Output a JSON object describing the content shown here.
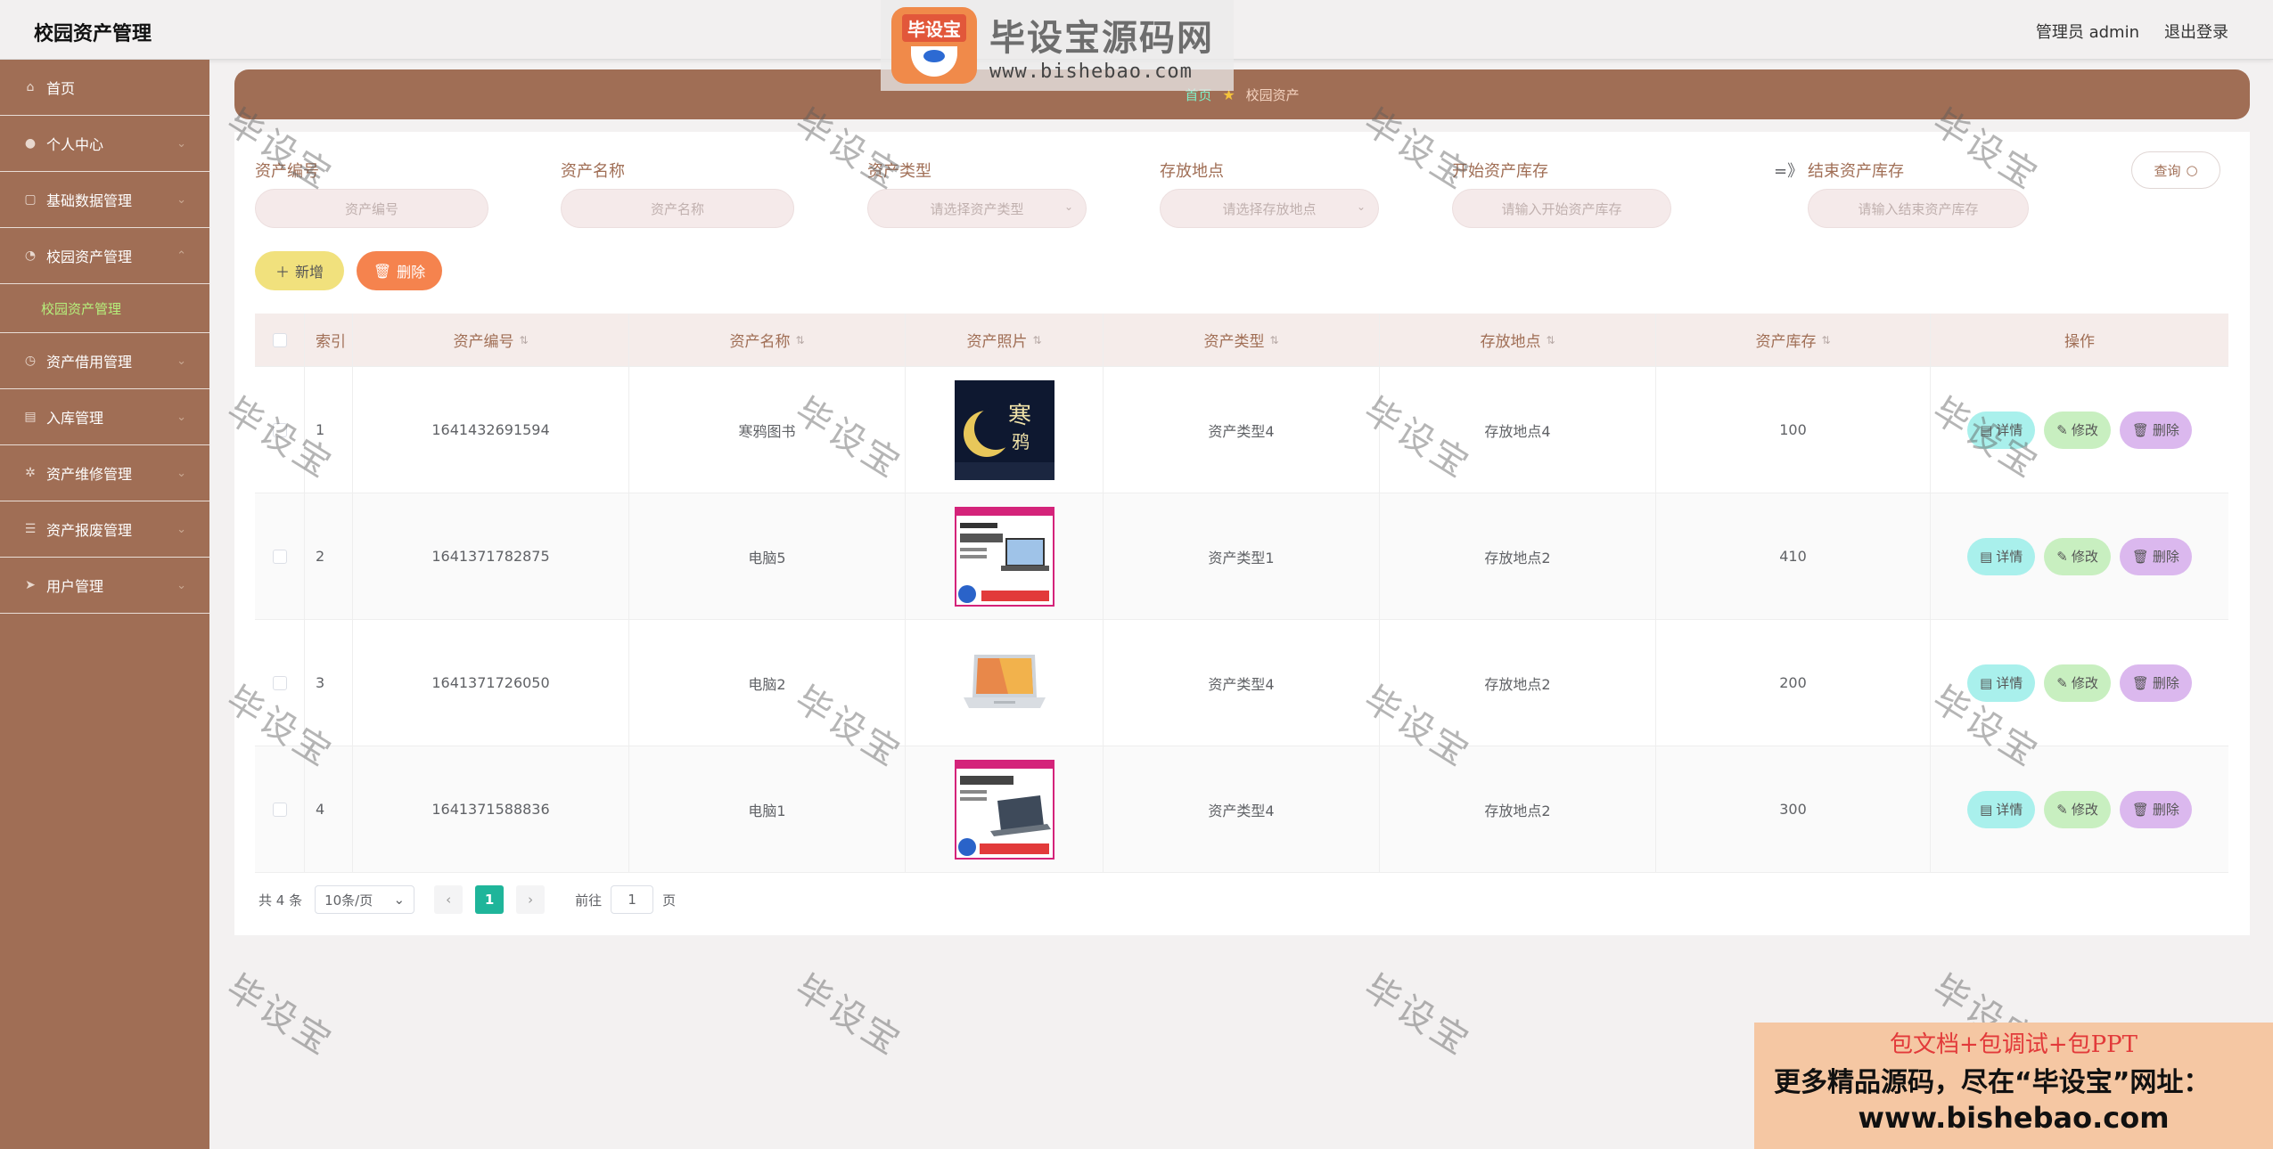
{
  "app": {
    "title": "校园资产管理"
  },
  "header": {
    "user_label": "管理员 admin",
    "logout_label": "退出登录"
  },
  "sidebar": {
    "items": [
      {
        "label": "首页",
        "icon": "home-icon",
        "glyph": "⌂",
        "has_children": false
      },
      {
        "label": "个人中心",
        "icon": "user-icon",
        "glyph": "●",
        "has_children": true
      },
      {
        "label": "基础数据管理",
        "icon": "document-icon",
        "glyph": "▢",
        "has_children": true
      },
      {
        "label": "校园资产管理",
        "icon": "chart-icon",
        "glyph": "◔",
        "has_children": true,
        "expanded": true,
        "children": [
          {
            "label": "校园资产管理"
          }
        ]
      },
      {
        "label": "资产借用管理",
        "icon": "clock-icon",
        "glyph": "◷",
        "has_children": true
      },
      {
        "label": "入库管理",
        "icon": "clipboard-icon",
        "glyph": "▤",
        "has_children": true
      },
      {
        "label": "资产维修管理",
        "icon": "gear-icon",
        "glyph": "✲",
        "has_children": true
      },
      {
        "label": "资产报废管理",
        "icon": "list-icon",
        "glyph": "☰",
        "has_children": true
      },
      {
        "label": "用户管理",
        "icon": "send-icon",
        "glyph": "➤",
        "has_children": true
      }
    ]
  },
  "breadcrumb": {
    "home": "首页",
    "current": "校园资产"
  },
  "search": {
    "fields": [
      {
        "label": "资产编号",
        "placeholder": "资产编号"
      },
      {
        "label": "资产名称",
        "placeholder": "资产名称"
      },
      {
        "label": "资产类型",
        "placeholder": "请选择资产类型"
      },
      {
        "label": "存放地点",
        "placeholder": "请选择存放地点"
      },
      {
        "label": "开始资产库存",
        "placeholder": "请输入开始资产库存"
      },
      {
        "label": "结束资产库存",
        "placeholder": "请输入结束资产库存"
      }
    ],
    "range_separator": "=》",
    "query_label": "查询"
  },
  "actions": {
    "add_label": "新增",
    "delete_label": "删除"
  },
  "table": {
    "columns": [
      "索引",
      "资产编号",
      "资产名称",
      "资产照片",
      "资产类型",
      "存放地点",
      "资产库存",
      "操作"
    ],
    "rows": [
      {
        "index": "1",
        "code": "1641432691594",
        "name": "寒鸦图书",
        "photo": "book-cover",
        "type": "资产类型4",
        "location": "存放地点4",
        "stock": "100"
      },
      {
        "index": "2",
        "code": "1641371782875",
        "name": "电脑5",
        "photo": "lenovo-ad-laptop",
        "type": "资产类型1",
        "location": "存放地点2",
        "stock": "410"
      },
      {
        "index": "3",
        "code": "1641371726050",
        "name": "电脑2",
        "photo": "silver-laptop",
        "type": "资产类型4",
        "location": "存放地点2",
        "stock": "200"
      },
      {
        "index": "4",
        "code": "1641371588836",
        "name": "电脑1",
        "photo": "lenovo-ad-laptop-2",
        "type": "资产类型4",
        "location": "存放地点2",
        "stock": "300"
      }
    ],
    "ops": {
      "detail": "详情",
      "edit": "修改",
      "remove": "删除"
    }
  },
  "pagination": {
    "total_label": "共 4 条",
    "page_size": "10条/页",
    "current_page": "1",
    "goto_prefix": "前往",
    "goto_value": "1",
    "goto_suffix": "页"
  },
  "watermark": {
    "text": "毕设宝",
    "logo_badge": "毕设宝",
    "logo_title": "毕设宝源码网",
    "logo_url": "www.bishebao.com"
  },
  "promo": {
    "line1": "包文档+包调试+包PPT",
    "line2": "更多精品源码，尽在“毕设宝”网址：",
    "line3": "www.bishebao.com"
  },
  "colors": {
    "sidebar": "#a06e55",
    "accent_green": "#1fb59a",
    "add_button": "#f1e17d",
    "delete_button": "#f5834e"
  }
}
